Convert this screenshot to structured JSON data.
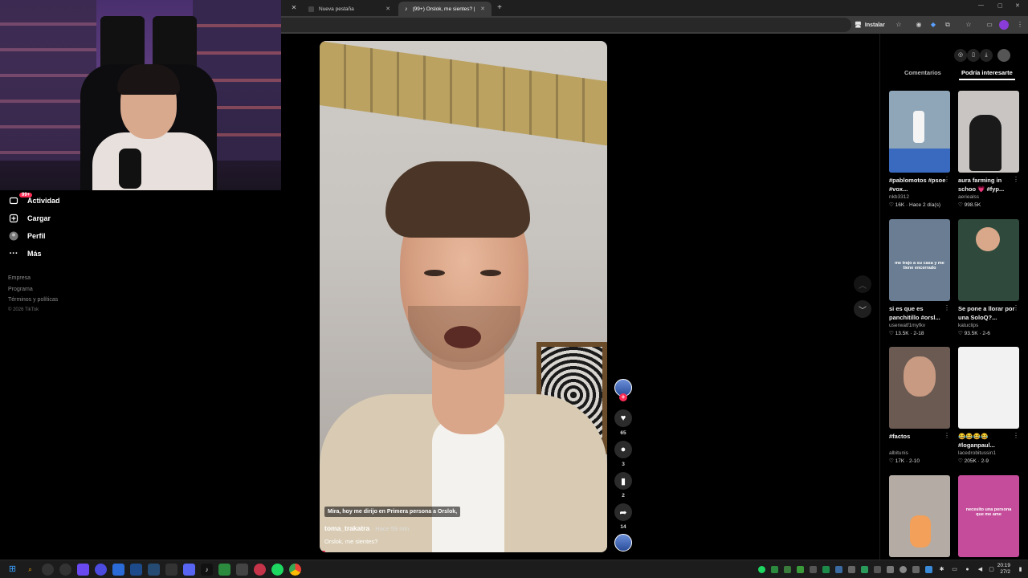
{
  "browser": {
    "tabs": [
      {
        "label": "Nueva pestaña",
        "active": false
      },
      {
        "label": "(99+) Orslok, me sientes? | TikTok",
        "active": true
      }
    ],
    "new_tab_symbol": "+",
    "install_label": "Instalar",
    "window_controls": [
      "—",
      "▢",
      "✕"
    ]
  },
  "sidebar": {
    "items": [
      {
        "label": "Actividad",
        "icon": "inbox-icon",
        "badge": "99+"
      },
      {
        "label": "Cargar",
        "icon": "upload-icon"
      },
      {
        "label": "Perfil",
        "icon": "avatar-icon"
      },
      {
        "label": "Más",
        "icon": "more-icon"
      }
    ],
    "footer_links": [
      "Empresa",
      "Programa",
      "Términos y políticas"
    ],
    "copyright": "© 2026 TikTok"
  },
  "video": {
    "caption_overlay": "Mira, hoy me dirijo en Primera persona a Orslok,",
    "author": "toma_trakatra",
    "time": "· Hace 59 min",
    "description": "Orslok, me sientes?",
    "progress": 0.02
  },
  "actions": {
    "likes": "65",
    "comments": "3",
    "saves": "2",
    "shares": "14",
    "follow_symbol": "+"
  },
  "right_panel": {
    "tabs": [
      "Comentarios",
      "Podría interesarte"
    ],
    "active_tab": "Podría interesarte",
    "cards": [
      {
        "title": "#pablomotos #psoe #vox...",
        "user": "nkb3312",
        "likes": "16K",
        "date": "Hace 2 día(s)",
        "bg": "#8fa6b8"
      },
      {
        "title": "aura farming in schoo 💗 #fyp...",
        "user": "aeriealss",
        "likes": "998.5K",
        "date": "",
        "bg": "#c9c5c2"
      },
      {
        "title": "si es que es panchitillo #orsl...",
        "user": "userwatf1myfkv",
        "likes": "13.5K",
        "date": "2-18",
        "bg": "#6a7d92"
      },
      {
        "title": "Se pone a llorar por una SoloQ?...",
        "user": "katuclips",
        "likes": "93.5K",
        "date": "2-6",
        "bg": "#2f4a3c"
      },
      {
        "title": "#factos",
        "user": "albitunis",
        "likes": "17K",
        "date": "2-10",
        "bg": "#6a5a52"
      },
      {
        "title": "😂😂😂😂 #loganpaul...",
        "user": "lacedrobitussin1",
        "likes": "205K",
        "date": "2-9",
        "bg": "#f2f2f2"
      },
      {
        "title": "",
        "user": "",
        "likes": "",
        "date": "",
        "bg": "#b3aba4"
      },
      {
        "title": "",
        "user": "",
        "likes": "",
        "date": "",
        "bg": "#c44c9a"
      }
    ],
    "thumb_overlays": {
      "card3": "me trajo a su casa y me tiene encerrado",
      "card8": "necesito una persona que me ame"
    }
  },
  "taskbar": {
    "time": "20:19",
    "date": "27/2"
  }
}
